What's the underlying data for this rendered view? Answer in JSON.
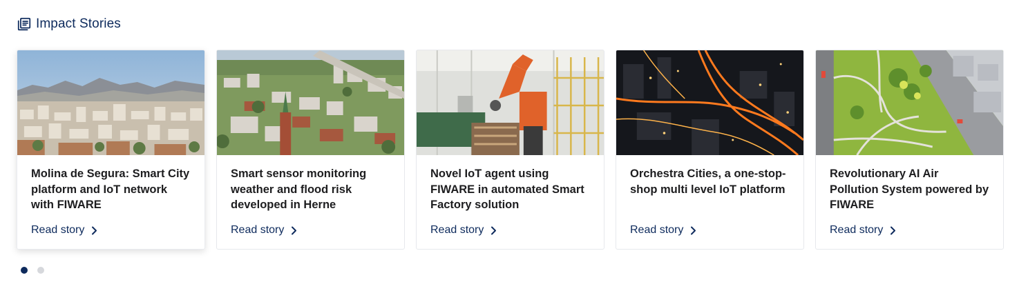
{
  "section": {
    "title": "Impact Stories",
    "icon": "newspaper-icon"
  },
  "colors": {
    "accent": "#0d2a5c",
    "title_text": "#1d1d1f",
    "dot_inactive": "#d6d8dc"
  },
  "cards": [
    {
      "title": "Molina de Segura: Smart City platform and IoT network with FIWARE",
      "link_label": "Read story",
      "image": "city-panorama-mountains"
    },
    {
      "title": "Smart sensor monitoring weather and flood risk developed in Herne",
      "link_label": "Read story",
      "image": "aerial-town-church-spire"
    },
    {
      "title": "Novel IoT agent using FIWARE in automated Smart Factory solution",
      "link_label": "Read story",
      "image": "orange-industrial-robot"
    },
    {
      "title": "Orchestra Cities, a one-stop-shop multi level IoT platform",
      "link_label": "Read story",
      "image": "night-city-lights"
    },
    {
      "title": "Revolutionary AI Air Pollution System powered by FIWARE",
      "link_label": "Read story",
      "image": "aerial-park-road"
    }
  ],
  "pagination": {
    "current": 1,
    "total": 2
  }
}
